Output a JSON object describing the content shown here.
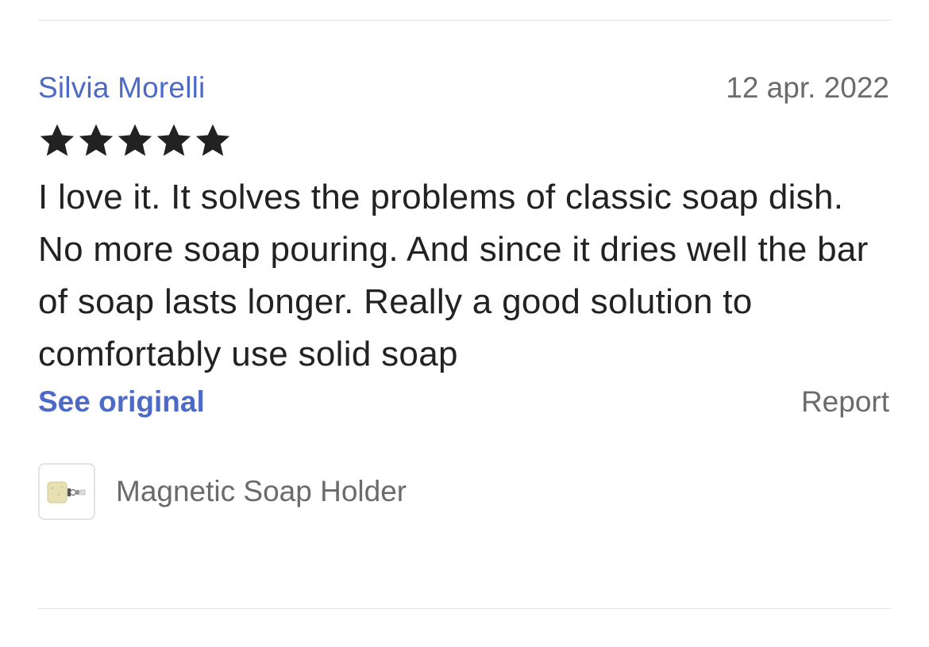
{
  "review": {
    "reviewer_name": "Silvia Morelli",
    "date": "12 apr. 2022",
    "rating": 5,
    "rating_max": 5,
    "text": "I love it. It solves the problems of classic soap dish. No more soap pouring. And since it dries well the bar of soap lasts longer. Really a good solution to comfortably use solid soap",
    "see_original_label": "See original",
    "report_label": "Report"
  },
  "product": {
    "name": "Magnetic Soap Holder",
    "thumbnail_icon": "soap-bar-thumbnail"
  },
  "colors": {
    "link_blue": "#4d6bc6",
    "muted_gray": "#6b6b6b",
    "text_dark": "#222222",
    "star": "#222222",
    "divider": "#e6e6e6"
  }
}
